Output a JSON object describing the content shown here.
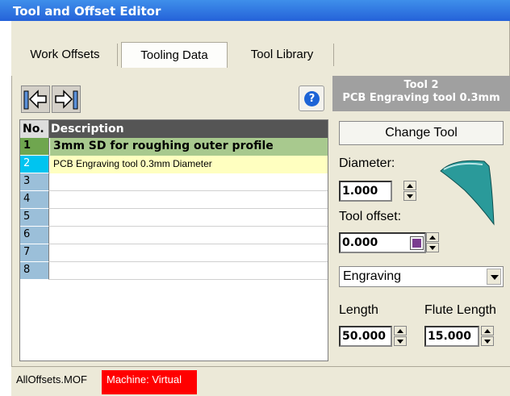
{
  "window": {
    "title": "Tool and Offset Editor"
  },
  "tabs": [
    {
      "label": "Work Offsets",
      "active": false
    },
    {
      "label": "Tooling Data",
      "active": true
    },
    {
      "label": "Tool Library",
      "active": false
    }
  ],
  "toolbar": {
    "icons": [
      "import-arrow-icon",
      "export-arrow-icon",
      "help-icon"
    ],
    "help_glyph": "?"
  },
  "grid": {
    "headers": [
      "No.",
      "Description"
    ],
    "rows": [
      {
        "no": "1",
        "description": "3mm SD for roughing outer profile"
      },
      {
        "no": "2",
        "description": "PCB Engraving tool 0.3mm Diameter"
      },
      {
        "no": "3",
        "description": ""
      },
      {
        "no": "4",
        "description": ""
      },
      {
        "no": "5",
        "description": ""
      },
      {
        "no": "6",
        "description": ""
      },
      {
        "no": "7",
        "description": ""
      },
      {
        "no": "8",
        "description": ""
      }
    ]
  },
  "tool_panel": {
    "title": "Tool 2",
    "subtitle": "PCB Engraving tool 0.3mm",
    "change_tool_label": "Change Tool",
    "diameter_label": "Diameter:",
    "diameter_value": "1.000",
    "tool_offset_label": "Tool offset:",
    "tool_offset_value": "0.000",
    "tool_type": "Engraving",
    "length_label": "Length",
    "length_value": "50.000",
    "flute_length_label": "Flute Length",
    "flute_length_value": "15.000"
  },
  "status": {
    "file": "AllOffsets.MOF",
    "machine": "Machine: Virtual"
  },
  "colors": {
    "title_bar": "#2562d9",
    "row_selected": "#a8c98e",
    "row_current": "#ffffc0",
    "machine_badge": "#ff0000"
  }
}
